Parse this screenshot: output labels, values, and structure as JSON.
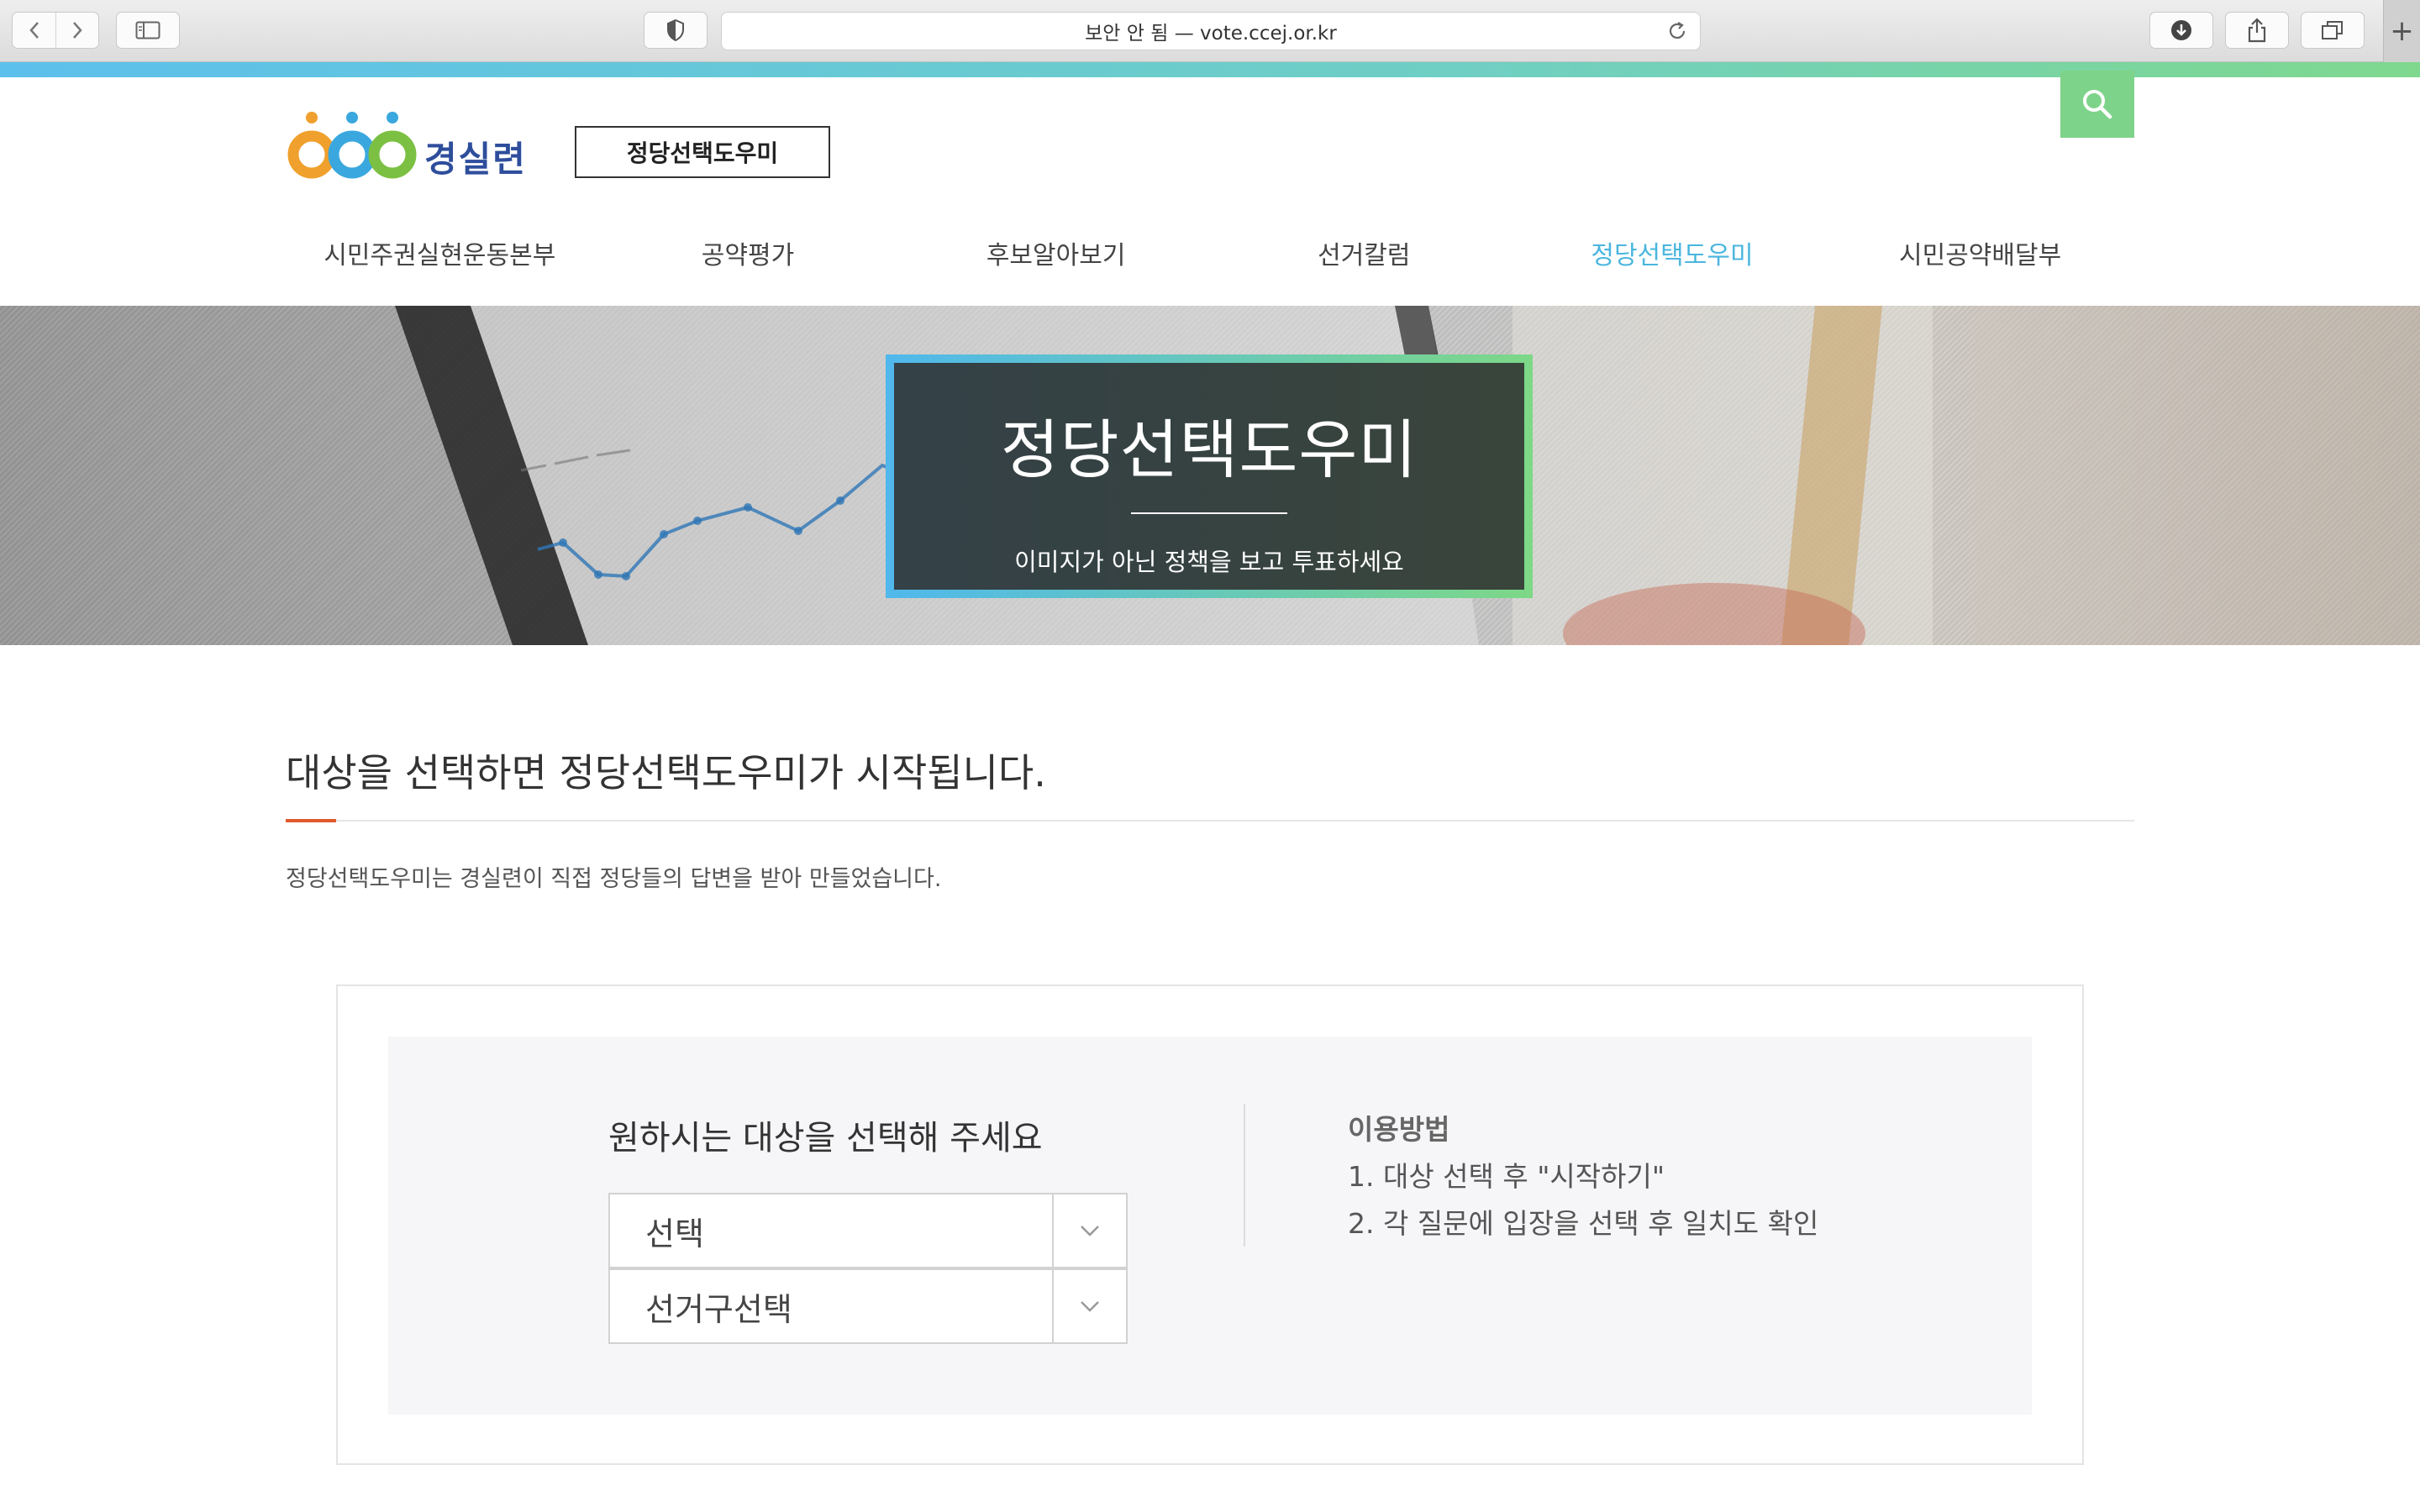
{
  "browser": {
    "address_text": "보안 안 됨 — vote.ccej.or.kr",
    "new_tab_symbol": "+"
  },
  "header": {
    "logo_text": "경실련",
    "site_tag": "정당선택도우미"
  },
  "nav": {
    "items": [
      {
        "label": "시민주권실현운동본부"
      },
      {
        "label": "공약평가"
      },
      {
        "label": "후보알아보기"
      },
      {
        "label": "선거칼럼"
      },
      {
        "label": "정당선택도우미",
        "active": true
      },
      {
        "label": "시민공약배달부"
      }
    ],
    "active_color": "#4ab6de"
  },
  "hero": {
    "title": "정당선택도우미",
    "subtitle": "이미지가 아닌 정책을 보고 투표하세요"
  },
  "main": {
    "section_title": "대상을 선택하면 정당선택도우미가 시작됩니다.",
    "section_desc": "정당선택도우미는 경실련이 직접 정당들의 답변을 받아 만들었습니다.",
    "accent_color": "#e0592b"
  },
  "selector": {
    "prompt": "원하시는 대상을 선택해 주세요",
    "target_select_value": "선택",
    "district_select_value": "선거구선택"
  },
  "howto": {
    "title": "이용방법",
    "steps": [
      "1. 대상 선택 후 \"시작하기\"",
      "2. 각 질문에 입장을 선택 후 일치도 확인"
    ]
  },
  "icons": {
    "back": "chevron-left-icon",
    "forward": "chevron-right-icon",
    "sidebar": "sidebar-icon",
    "shield": "shield-icon",
    "reload": "reload-icon",
    "download": "download-icon",
    "share": "share-icon",
    "tabs": "tabs-icon",
    "search": "search-icon",
    "select_arrow": "chevron-down-icon"
  },
  "colors": {
    "search_button": "#7ed38a",
    "hero_border_start": "#50b8ec",
    "hero_border_end": "#7dd887"
  }
}
